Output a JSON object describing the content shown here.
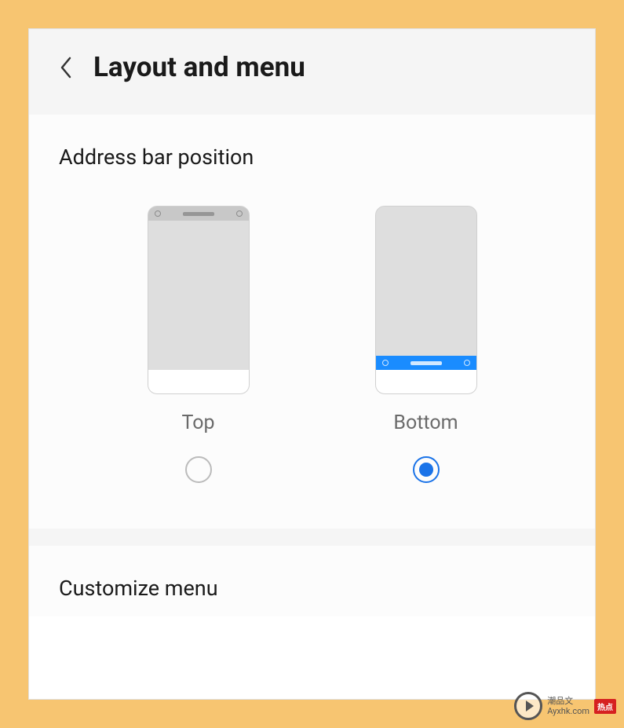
{
  "header": {
    "title": "Layout and menu"
  },
  "addressBar": {
    "sectionTitle": "Address bar position",
    "options": {
      "top": {
        "label": "Top",
        "selected": false
      },
      "bottom": {
        "label": "Bottom",
        "selected": true
      }
    }
  },
  "customize": {
    "label": "Customize menu"
  },
  "watermark": {
    "text1": "潮品文",
    "text2": "Ayxhk.com",
    "badge": "热点"
  },
  "colors": {
    "accent": "#1a73e8",
    "blueBar": "#1a8cff",
    "background": "#f7c571"
  }
}
